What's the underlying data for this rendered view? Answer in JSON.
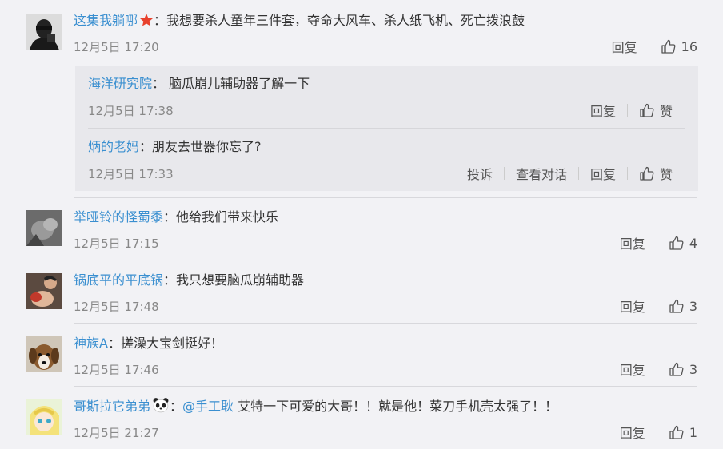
{
  "comments": [
    {
      "user": "这集我躺哪",
      "text": "：我想要杀人童年三件套，夺命大风车、杀人纸飞机、死亡拨浪鼓",
      "time": "12月5日 17:20",
      "reply": "回复",
      "likes": "16"
    },
    {
      "user": "举哑铃的怪蜀黍",
      "text": "：他给我们带来快乐",
      "time": "12月5日 17:15",
      "reply": "回复",
      "likes": "4"
    },
    {
      "user": "锅底平的平底锅",
      "text": "：我只想要脑瓜崩辅助器",
      "time": "12月5日 17:48",
      "reply": "回复",
      "likes": "3"
    },
    {
      "user": "神族A",
      "text": "：搓澡大宝剑挺好！",
      "time": "12月5日 17:46",
      "reply": "回复",
      "likes": "3"
    },
    {
      "user": "哥斯拉它弟弟",
      "colon": "：",
      "mention": "@手工耿",
      "text": " 艾特一下可爱的大哥！！就是他！菜刀手机壳太强了！！",
      "time": "12月5日 21:27",
      "reply": "回复",
      "likes": "1"
    }
  ],
  "replies": [
    {
      "user": "海洋研究院",
      "text": "：  脑瓜崩儿辅助器了解一下",
      "time": "12月5日 17:38",
      "reply": "回复",
      "like": "赞"
    },
    {
      "user": "炳的老妈",
      "text": "：朋友去世器你忘了?",
      "time": "12月5日 17:33",
      "report": "投诉",
      "view_convo": "查看对话",
      "reply": "回复",
      "like": "赞"
    }
  ],
  "colors": {
    "link": "#3a8fd0",
    "time": "#888888",
    "bg": "#f2f2f5",
    "reply_bg": "#e8e8ec"
  },
  "icons": [
    "star-badge-icon",
    "panda-emoji-icon",
    "thumbs-up-icon"
  ]
}
